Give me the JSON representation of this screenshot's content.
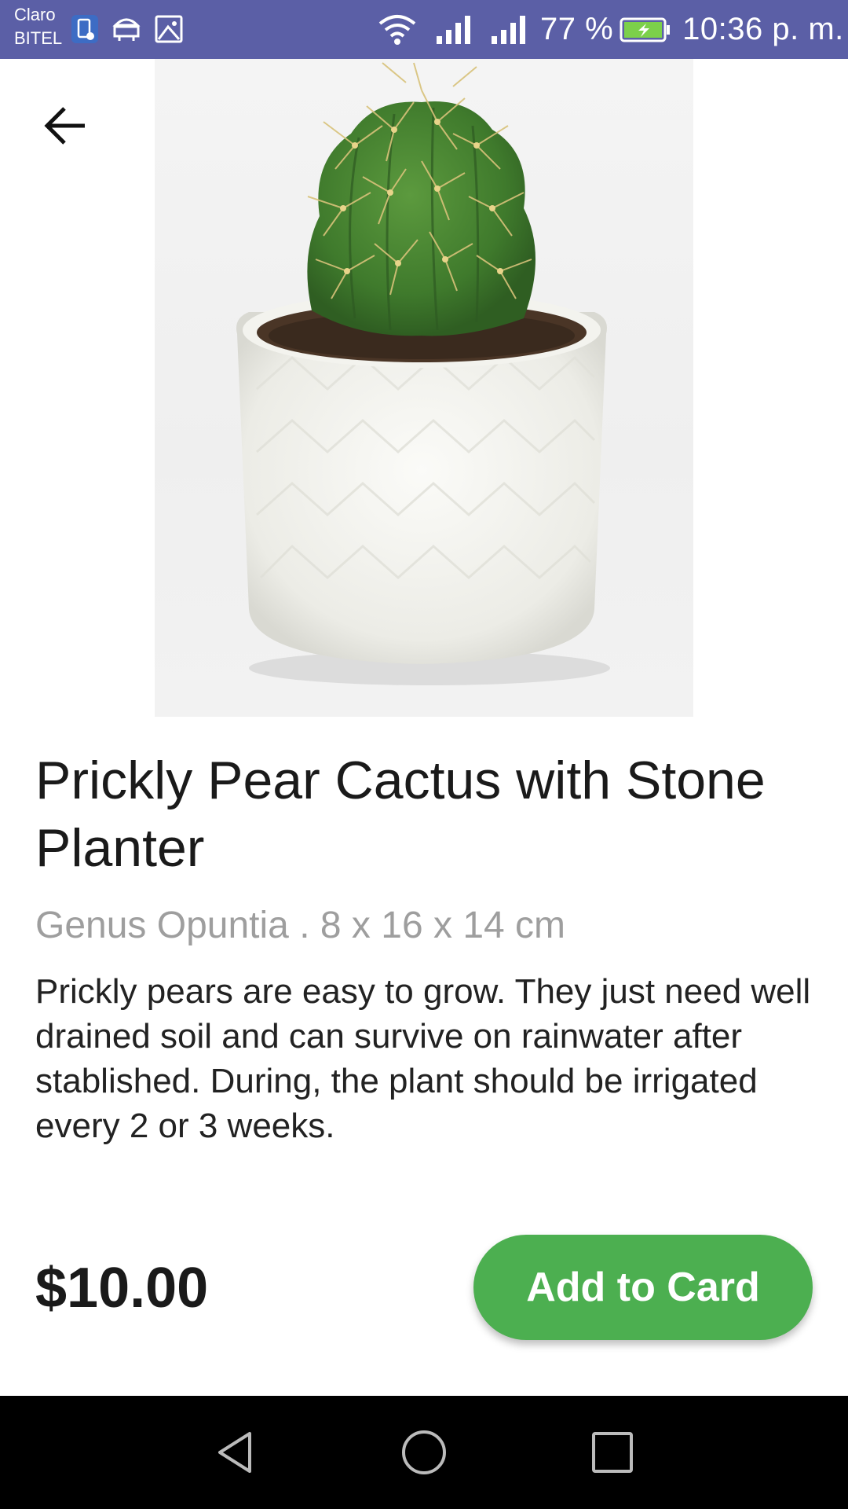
{
  "status_bar": {
    "carrier_1": "Claro",
    "carrier_2": "BITEL",
    "battery_percent": "77 %",
    "time": "10:36 p. m.",
    "background_color": "#5b5fa6",
    "icons": [
      "notification-icon",
      "android-icon",
      "image-icon",
      "wifi-icon",
      "signal-icon",
      "signal-icon",
      "battery-charging-icon"
    ]
  },
  "product": {
    "title": "Prickly Pear Cactus with Stone Planter",
    "subtitle": "Genus Opuntia . 8 x 16 x 14 cm",
    "description": "Prickly pears are easy to grow. They just need well drained soil and can survive on rainwater after stablished. During, the plant should be irrigated every 2 or 3 weeks.",
    "price": "$10.00",
    "image_icon": "cactus-in-white-pot-photo"
  },
  "actions": {
    "back_icon": "arrow-left-icon",
    "add_button_label": "Add to Card",
    "accent_color": "#4caf50"
  },
  "nav_bar": {
    "icons": [
      "back-triangle-icon",
      "home-circle-icon",
      "recents-square-icon"
    ]
  }
}
